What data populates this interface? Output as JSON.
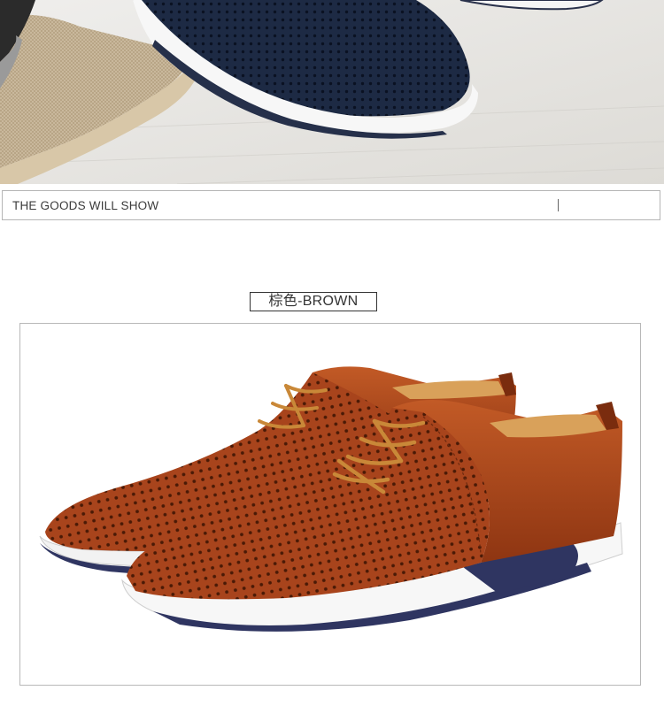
{
  "banner": {
    "photo_subject": "navy perforated leather sneakers and beige canvas shoe on light wood floor"
  },
  "section": {
    "title": "THE GOODS WILL SHOW"
  },
  "variant": {
    "label": "棕色-BROWN"
  },
  "product": {
    "photo_subject": "pair of brown perforated leather lace-up shoes with white soles",
    "colors": {
      "leather": "#a8441c",
      "leather_dark": "#6e2a10",
      "lining": "#d9a15a",
      "sole": "#f4f4f4",
      "sole_stripe": "#2f3561"
    }
  }
}
